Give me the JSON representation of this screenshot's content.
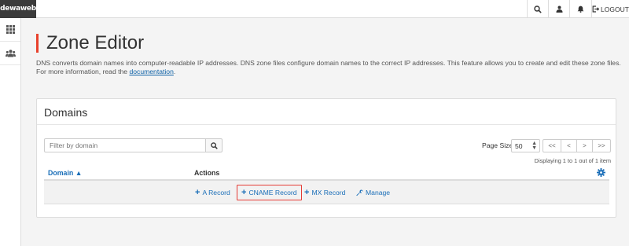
{
  "brand": {
    "name": "dewaweb"
  },
  "topbar": {
    "search_icon": "search-icon",
    "user_icon": "user-icon",
    "bell_icon": "bell-icon",
    "logout_label": "LOGOUT"
  },
  "rail": {
    "items": [
      "apps-grid-icon",
      "users-icon"
    ]
  },
  "page": {
    "title": "Zone Editor",
    "description_prefix": "DNS converts domain names into computer-readable IP addresses. DNS zone files configure domain names to the correct IP addresses. This feature allows you to create and edit these zone files. For more information, read the ",
    "description_link": "documentation",
    "description_suffix": "."
  },
  "domains_panel": {
    "title": "Domains",
    "filter_placeholder": "Filter by domain",
    "page_size_label": "Page Size",
    "page_size_value": "50",
    "pager": {
      "first": "<<",
      "prev": "<",
      "next": ">",
      "last": ">>"
    },
    "displaying": "Displaying 1 to 1 out of 1 item",
    "columns": {
      "domain": "Domain",
      "domain_sort": "▲",
      "actions": "Actions"
    },
    "row_actions": {
      "a_record": "A Record",
      "cname_record": "CNAME Record",
      "mx_record": "MX Record",
      "manage": "Manage"
    }
  },
  "colors": {
    "accent": "#e8412c",
    "link": "#1a6eb8",
    "highlight_border": "#e53b35"
  }
}
